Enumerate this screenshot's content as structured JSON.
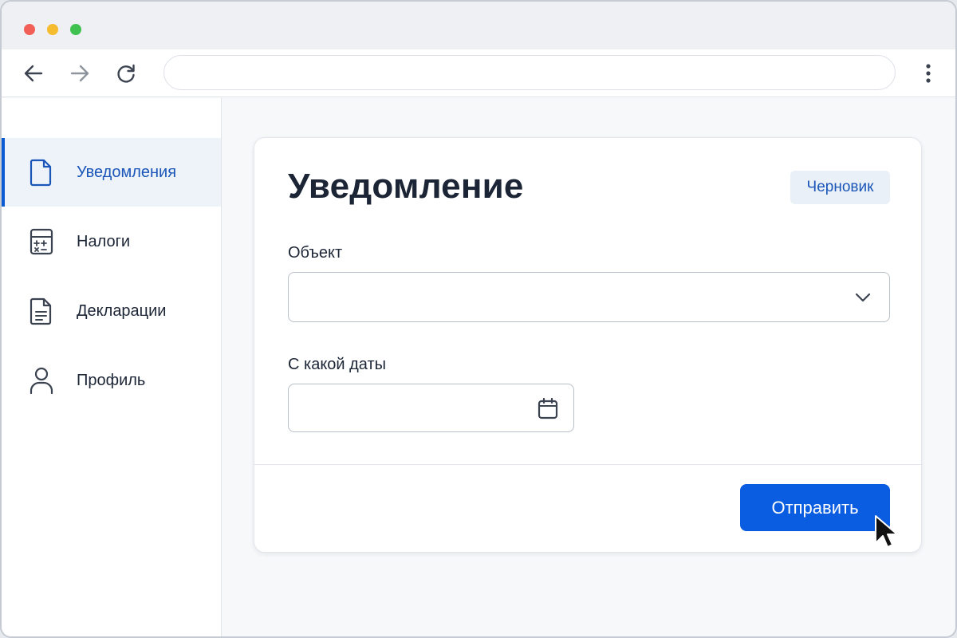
{
  "browser": {
    "address_value": "",
    "icons": {
      "back": "arrow-left-icon",
      "forward": "arrow-right-icon",
      "reload": "reload-icon",
      "menu": "kebab-menu-icon"
    }
  },
  "sidebar": {
    "items": [
      {
        "label": "Уведомления",
        "icon": "document-icon",
        "active": true
      },
      {
        "label": "Налоги",
        "icon": "calculator-icon",
        "active": false
      },
      {
        "label": "Декларации",
        "icon": "document-lines-icon",
        "active": false
      },
      {
        "label": "Профиль",
        "icon": "user-icon",
        "active": false
      }
    ]
  },
  "form": {
    "title": "Уведомление",
    "status_badge": "Черновик",
    "object_label": "Объект",
    "object_value": "",
    "date_label": "С какой даты",
    "date_value": "",
    "submit_label": "Отправить"
  },
  "colors": {
    "accent": "#0a5ce0",
    "accent_text": "#1a56b8",
    "active_bg": "#eef3fa",
    "badge_bg": "#eaf0f7"
  }
}
